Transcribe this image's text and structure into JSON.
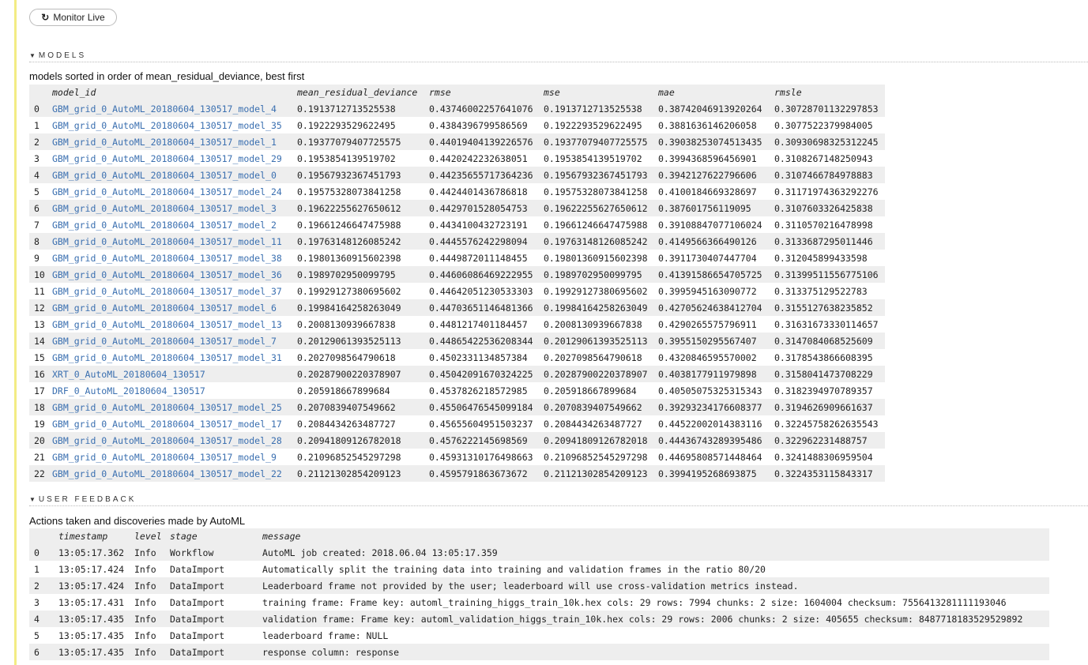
{
  "toolbar": {
    "monitor_live_label": "Monitor Live",
    "monitor_icon": "refresh-icon"
  },
  "models": {
    "section_title": "MODELS",
    "caption": "models sorted in order of mean_residual_deviance, best first",
    "columns": [
      "",
      "model_id",
      "mean_residual_deviance",
      "rmse",
      "mse",
      "mae",
      "rmsle"
    ],
    "rows": [
      [
        "0",
        "GBM_grid_0_AutoML_20180604_130517_model_4",
        "0.1913712713525538",
        "0.43746002257641076",
        "0.1913712713525538",
        "0.38742046913920264",
        "0.30728701132297853"
      ],
      [
        "1",
        "GBM_grid_0_AutoML_20180604_130517_model_35",
        "0.1922293529622495",
        "0.4384396799586569",
        "0.1922293529622495",
        "0.3881636146206058",
        "0.3077522379984005"
      ],
      [
        "2",
        "GBM_grid_0_AutoML_20180604_130517_model_1",
        "0.19377079407725575",
        "0.44019404139226576",
        "0.19377079407725575",
        "0.39038253074513435",
        "0.30930698325312245"
      ],
      [
        "3",
        "GBM_grid_0_AutoML_20180604_130517_model_29",
        "0.1953854139519702",
        "0.4420242232638051",
        "0.1953854139519702",
        "0.3994368596456901",
        "0.3108267148250943"
      ],
      [
        "4",
        "GBM_grid_0_AutoML_20180604_130517_model_0",
        "0.19567932367451793",
        "0.44235655717364236",
        "0.19567932367451793",
        "0.3942127622796606",
        "0.3107466784978883"
      ],
      [
        "5",
        "GBM_grid_0_AutoML_20180604_130517_model_24",
        "0.19575328073841258",
        "0.4424401436786818",
        "0.19575328073841258",
        "0.4100184669328697",
        "0.31171974363292276"
      ],
      [
        "6",
        "GBM_grid_0_AutoML_20180604_130517_model_3",
        "0.19622255627650612",
        "0.4429701528054753",
        "0.19622255627650612",
        "0.387601756119095",
        "0.3107603326425838"
      ],
      [
        "7",
        "GBM_grid_0_AutoML_20180604_130517_model_2",
        "0.19661246647475988",
        "0.4434100432723191",
        "0.19661246647475988",
        "0.39108847077106024",
        "0.3110570216478998"
      ],
      [
        "8",
        "GBM_grid_0_AutoML_20180604_130517_model_11",
        "0.19763148126085242",
        "0.4445576242298094",
        "0.19763148126085242",
        "0.4149566366490126",
        "0.3133687295011446"
      ],
      [
        "9",
        "GBM_grid_0_AutoML_20180604_130517_model_38",
        "0.19801360915602398",
        "0.4449872011148455",
        "0.19801360915602398",
        "0.3911730407447704",
        "0.312045899433598"
      ],
      [
        "10",
        "GBM_grid_0_AutoML_20180604_130517_model_36",
        "0.1989702950099795",
        "0.44606086469222955",
        "0.1989702950099795",
        "0.41391586654705725",
        "0.31399511556775106"
      ],
      [
        "11",
        "GBM_grid_0_AutoML_20180604_130517_model_37",
        "0.19929127380695602",
        "0.44642051230533303",
        "0.19929127380695602",
        "0.3995945163090772",
        "0.313375129522783"
      ],
      [
        "12",
        "GBM_grid_0_AutoML_20180604_130517_model_6",
        "0.19984164258263049",
        "0.44703651146481366",
        "0.19984164258263049",
        "0.42705624638412704",
        "0.3155127638235852"
      ],
      [
        "13",
        "GBM_grid_0_AutoML_20180604_130517_model_13",
        "0.2008130939667838",
        "0.4481217401184457",
        "0.2008130939667838",
        "0.4290265575796911",
        "0.31631673330114657"
      ],
      [
        "14",
        "GBM_grid_0_AutoML_20180604_130517_model_7",
        "0.20129061393525113",
        "0.44865422536208344",
        "0.20129061393525113",
        "0.3955150295567407",
        "0.3147084068525609"
      ],
      [
        "15",
        "GBM_grid_0_AutoML_20180604_130517_model_31",
        "0.2027098564790618",
        "0.4502331134857384",
        "0.2027098564790618",
        "0.4320846595570002",
        "0.3178543866608395"
      ],
      [
        "16",
        "XRT_0_AutoML_20180604_130517",
        "0.20287900220378907",
        "0.45042091670324225",
        "0.20287900220378907",
        "0.4038177911979898",
        "0.3158041473708229"
      ],
      [
        "17",
        "DRF_0_AutoML_20180604_130517",
        "0.205918667899684",
        "0.4537826218572985",
        "0.205918667899684",
        "0.40505075325315343",
        "0.3182394970789357"
      ],
      [
        "18",
        "GBM_grid_0_AutoML_20180604_130517_model_25",
        "0.2070839407549662",
        "0.45506476545099184",
        "0.2070839407549662",
        "0.39293234176608377",
        "0.3194626909661637"
      ],
      [
        "19",
        "GBM_grid_0_AutoML_20180604_130517_model_17",
        "0.2084434263487727",
        "0.45655604951503237",
        "0.2084434263487727",
        "0.44522002014383116",
        "0.32245758262635543"
      ],
      [
        "20",
        "GBM_grid_0_AutoML_20180604_130517_model_28",
        "0.20941809126782018",
        "0.4576222145698569",
        "0.20941809126782018",
        "0.44436743289395486",
        "0.322962231488757"
      ],
      [
        "21",
        "GBM_grid_0_AutoML_20180604_130517_model_9",
        "0.21096852545297298",
        "0.45931310176498663",
        "0.21096852545297298",
        "0.44695808571448464",
        "0.3241488306959504"
      ],
      [
        "22",
        "GBM_grid_0_AutoML_20180604_130517_model_22",
        "0.21121302854209123",
        "0.4595791863673672",
        "0.21121302854209123",
        "0.3994195268693875",
        "0.3224353115843317"
      ]
    ]
  },
  "feedback": {
    "section_title": "USER FEEDBACK",
    "caption": "Actions taken and discoveries made by AutoML",
    "columns": [
      "",
      "timestamp",
      "level",
      "stage",
      "message"
    ],
    "rows": [
      [
        "0",
        "13:05:17.362",
        "Info",
        "Workflow",
        "AutoML job created: 2018.06.04 13:05:17.359"
      ],
      [
        "1",
        "13:05:17.424",
        "Info",
        "DataImport",
        "Automatically split the training data into training and validation frames in the ratio 80/20"
      ],
      [
        "2",
        "13:05:17.424",
        "Info",
        "DataImport",
        "Leaderboard frame not provided by the user; leaderboard will use cross-validation metrics instead."
      ],
      [
        "3",
        "13:05:17.431",
        "Info",
        "DataImport",
        "training frame: Frame key: automl_training_higgs_train_10k.hex cols: 29 rows: 7994 chunks: 2 size: 1604004 checksum: 7556413281111193046"
      ],
      [
        "4",
        "13:05:17.435",
        "Info",
        "DataImport",
        "validation frame: Frame key: automl_validation_higgs_train_10k.hex cols: 29 rows: 2006 chunks: 2 size: 405655 checksum: 8487718183529529892"
      ],
      [
        "5",
        "13:05:17.435",
        "Info",
        "DataImport",
        "leaderboard frame: NULL"
      ],
      [
        "6",
        "13:05:17.435",
        "Info",
        "DataImport",
        "response column: response"
      ]
    ]
  },
  "colors": {
    "link": "#3a6fb0",
    "left_bar": "#f3ec84",
    "stripe": "#eeeeee"
  }
}
